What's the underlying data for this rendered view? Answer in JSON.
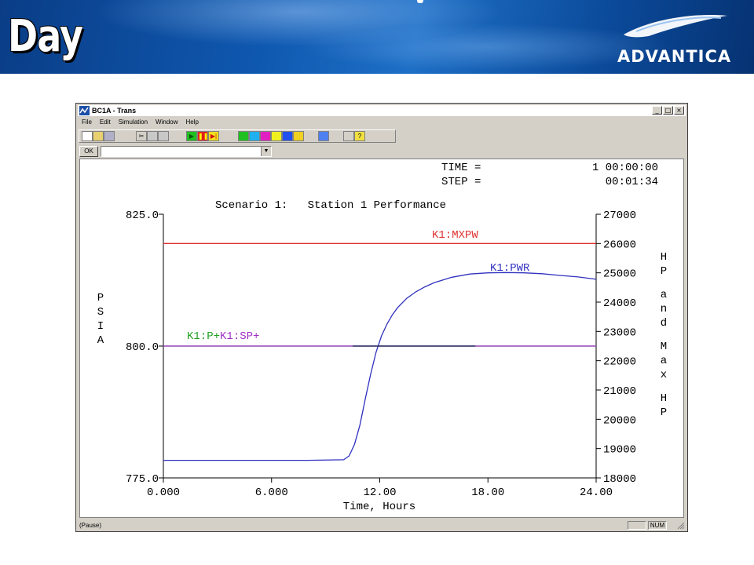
{
  "slide": {
    "title": "Day",
    "logo_text": "ADVANTICA"
  },
  "window": {
    "title": "BC1A - Trans",
    "caption_buttons": [
      "_",
      "□",
      "×"
    ],
    "menu": [
      "File",
      "Edit",
      "Simulation",
      "Window",
      "Help"
    ],
    "toolbar_icons": [
      "new-icon",
      "open-icon",
      "save-icon",
      "cut-icon",
      "copy-icon",
      "paste-icon",
      "run-icon",
      "pause-icon",
      "step-icon",
      "chart-icon",
      "clock-icon",
      "stop-icon",
      "palette-icon",
      "window-icon",
      "graph-icon",
      "refresh-icon",
      "print-icon",
      "help-icon"
    ],
    "ok_label": "OK",
    "command_value": "",
    "status_text": "(Pause)",
    "status_num": "NUM"
  },
  "readout": {
    "time_label": "TIME =",
    "time_value": "1 00:00:00",
    "step_label": "STEP =",
    "step_value": "00:01:34"
  },
  "chart_data": {
    "type": "line",
    "title": "Scenario 1:   Station 1 Performance",
    "xlabel": "Time, Hours",
    "ylabel_left": "PSIA",
    "ylabel_right": "HP and Max HP",
    "xlim": [
      0,
      24
    ],
    "ylim_left": [
      775,
      825
    ],
    "ylim_right": [
      18000,
      27000
    ],
    "x_ticks": [
      "0.000",
      "6.000",
      "12.00",
      "18.00",
      "24.00"
    ],
    "y_left_ticks": [
      "825.0",
      "800.0",
      "775.0"
    ],
    "y_right_ticks": [
      "27000",
      "26000",
      "25000",
      "24000",
      "23000",
      "22000",
      "21000",
      "20000",
      "19000",
      "18000"
    ],
    "grid": false,
    "series": [
      {
        "name": "K1:MXPW",
        "axis": "right",
        "color": "#e03030",
        "x": [
          0,
          24
        ],
        "y": [
          26000,
          26000
        ]
      },
      {
        "name": "K1:PWR",
        "axis": "right",
        "color": "#3030c0",
        "x": [
          0,
          8,
          10.0,
          10.3,
          10.6,
          10.9,
          11.2,
          11.5,
          11.8,
          12.1,
          12.4,
          12.7,
          13.0,
          13.5,
          14.0,
          14.5,
          15.0,
          16.0,
          17.0,
          18.0,
          19.0,
          20.0,
          21.0,
          22.0,
          23.0,
          24.0
        ],
        "y": [
          18600,
          18600,
          18620,
          18750,
          19150,
          19800,
          20700,
          21550,
          22300,
          22850,
          23250,
          23570,
          23820,
          24130,
          24350,
          24520,
          24660,
          24850,
          24960,
          25000,
          25010,
          25000,
          24970,
          24910,
          24860,
          24780
        ]
      },
      {
        "name": "K1:P",
        "axis": "left",
        "color": "#20a020",
        "x": [
          0,
          24
        ],
        "y": [
          800,
          800
        ]
      },
      {
        "name": "K1:SP",
        "axis": "left",
        "color": "#a030c8",
        "x": [
          0,
          24
        ],
        "y": [
          800,
          800
        ]
      },
      {
        "name": "",
        "axis": "left",
        "color": "#1a1a5a",
        "x": [
          10.5,
          17.3
        ],
        "y": [
          800,
          800
        ]
      }
    ],
    "annotations": [
      {
        "text": "K1:MXPW",
        "color": "#e03030"
      },
      {
        "text": "K1:PWR",
        "color": "#3030c0"
      },
      {
        "text": "K1:P+",
        "color": "#20a020"
      },
      {
        "text": "K1:SP+",
        "color": "#a030c8"
      }
    ]
  }
}
